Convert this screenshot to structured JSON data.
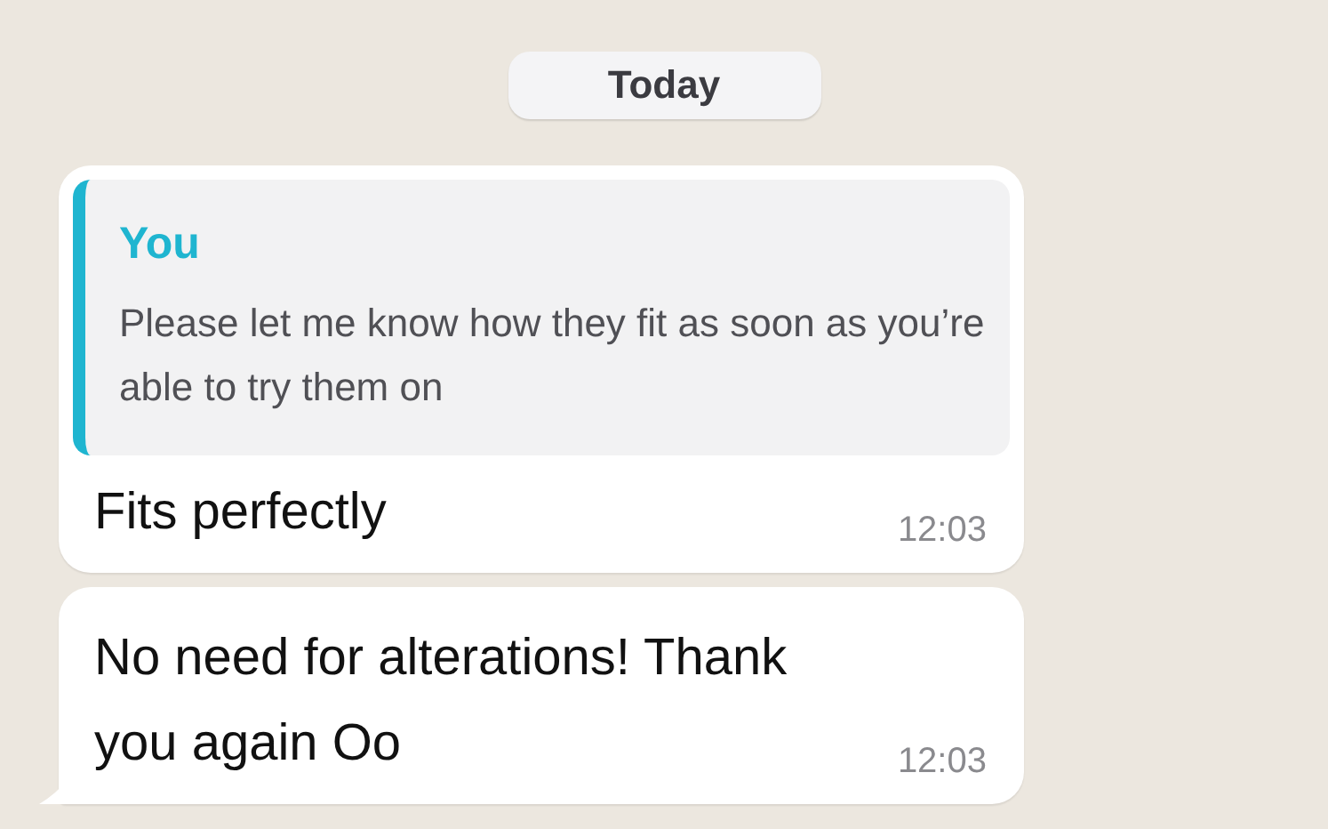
{
  "date_chip": "Today",
  "messages": [
    {
      "kind": "reply",
      "quote": {
        "author": "You",
        "text": "Please let me know how they fit as soon as you’re able to try them on"
      },
      "text": "Fits perfectly",
      "time": "12:03",
      "tail": false
    },
    {
      "kind": "plain",
      "text": "No need for alterations! Thank you again Oo",
      "time": "12:03",
      "tail": true
    }
  ]
}
